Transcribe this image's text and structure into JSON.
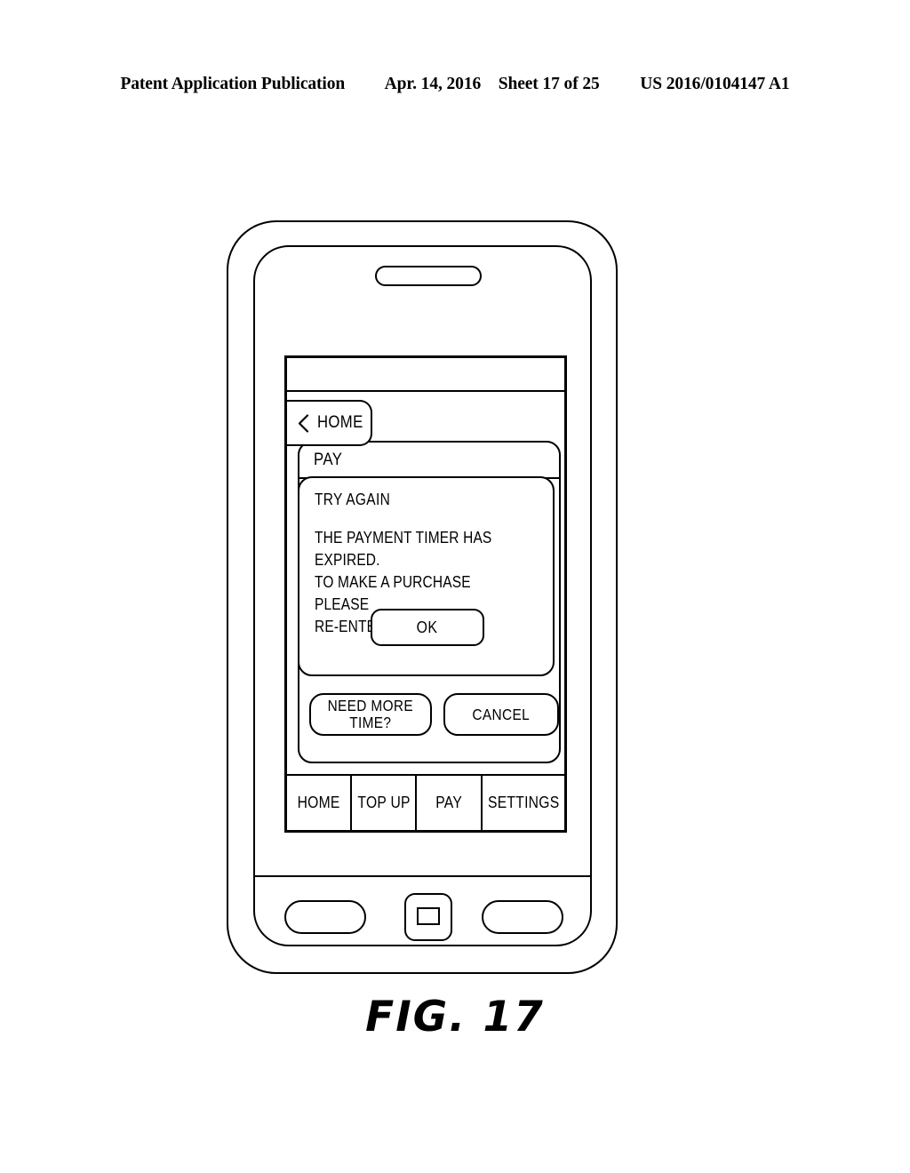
{
  "header": {
    "publication": "Patent Application Publication",
    "date": "Apr. 14, 2016",
    "sheet": "Sheet 17 of 25",
    "patent_number": "US 2016/0104147 A1"
  },
  "figure": {
    "caption": "FIG.  17"
  },
  "phone": {
    "speaker_name": "earpiece-speaker",
    "hardware": {
      "left_button": "menu-key",
      "home_button": "home-key",
      "right_button": "back-key"
    }
  },
  "screen": {
    "status_bar": "",
    "back_button": {
      "label": "HOME",
      "icon": "chevron-left-icon"
    },
    "pay_panel": {
      "title": "PAY"
    },
    "alert": {
      "heading": "TRY AGAIN",
      "body": "THE PAYMENT TIMER HAS EXPIRED.\nTO MAKE A PURCHASE PLEASE\nRE-ENTER YOUR PIN.",
      "ok_label": "OK"
    },
    "actions": {
      "need_more_time": "NEED MORE\nTIME?",
      "cancel": "CANCEL"
    },
    "tabs": [
      {
        "label": "HOME"
      },
      {
        "label": "TOP UP"
      },
      {
        "label": "PAY"
      },
      {
        "label": "SETTINGS"
      }
    ]
  },
  "colors": {
    "ink": "#000000",
    "paper": "#ffffff"
  }
}
